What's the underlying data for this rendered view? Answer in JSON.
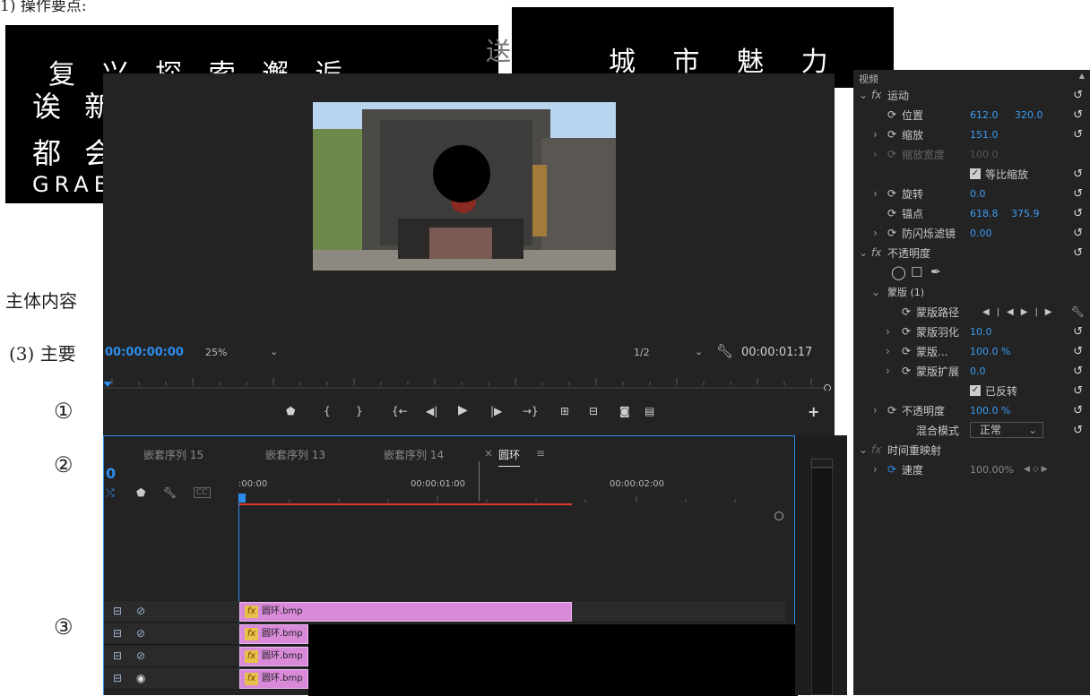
{
  "document": {
    "top_line": "1) 操作要点:",
    "main_line": "主体内容",
    "item3": "(3) 主要",
    "circled": [
      "①",
      "②",
      "③"
    ]
  },
  "title_images": {
    "left_rows": [
      "复 兴     探 索     邂 逅",
      "诶 新",
      "都 会",
      "GRAB"
    ],
    "right_text": "城 市 魅 力",
    "mid_fragment": "送"
  },
  "program_monitor": {
    "timecode_current": "00:00:00:00",
    "zoom": "25%",
    "resolution": "1/2",
    "timecode_duration": "00:00:01:17",
    "buttons": [
      "marker-icon",
      "in-point-icon",
      "out-point-icon",
      "go-to-in-icon",
      "step-back-icon",
      "play-icon",
      "step-forward-icon",
      "go-to-out-icon",
      "lift-icon",
      "extract-icon",
      "export-frame-icon",
      "multi-camera-icon"
    ]
  },
  "timeline": {
    "tabs": [
      "嵌套序列 15",
      "嵌套序列 13",
      "嵌套序列 14",
      "圆环"
    ],
    "active_tab_close": "×",
    "active_tab_menu": "≡",
    "playhead_timecode": "0",
    "ruler_labels": [
      ":00:00",
      "00:00:01:00",
      "00:00:02:00"
    ],
    "cc_label": "CC",
    "clips": [
      "圆环.bmp",
      "圆环.bmp",
      "圆环.bmp",
      "圆环.bmp"
    ],
    "fx_label": "fx"
  },
  "effect_controls": {
    "header": "视频",
    "rows": [
      {
        "label": "运动",
        "kind": "fx"
      },
      {
        "label": "位置",
        "v1": "612.0",
        "v2": "320.0"
      },
      {
        "label": "缩放",
        "v1": "151.0"
      },
      {
        "label": "缩放宽度",
        "v1": "100.0"
      },
      {
        "label": "等比缩放"
      },
      {
        "label": "旋转",
        "v1": "0.0"
      },
      {
        "label": "锚点",
        "v1": "618.8",
        "v2": "375.9"
      },
      {
        "label": "防闪烁滤镜",
        "v1": "0.00"
      },
      {
        "label": "不透明度",
        "kind": "fx"
      },
      {
        "label": "蒙版 (1)"
      },
      {
        "label": "蒙版路径"
      },
      {
        "label": "蒙版羽化",
        "v1": "10.0"
      },
      {
        "label": "蒙版...",
        "v1": "100.0 %"
      },
      {
        "label": "蒙版扩展",
        "v1": "0.0"
      },
      {
        "label": "已反转"
      },
      {
        "label": "不透明度",
        "v1": "100.0 %"
      },
      {
        "label": "混合模式",
        "v1": "正常"
      },
      {
        "label": "时间重映射",
        "kind": "fx"
      },
      {
        "label": "速度",
        "v1": "100.00%"
      }
    ]
  },
  "colors": {
    "panel": "#232323",
    "accent_blue": "#2d8ceb",
    "clip_pink": "#d88ad8",
    "work_area_red": "#e0392b"
  }
}
